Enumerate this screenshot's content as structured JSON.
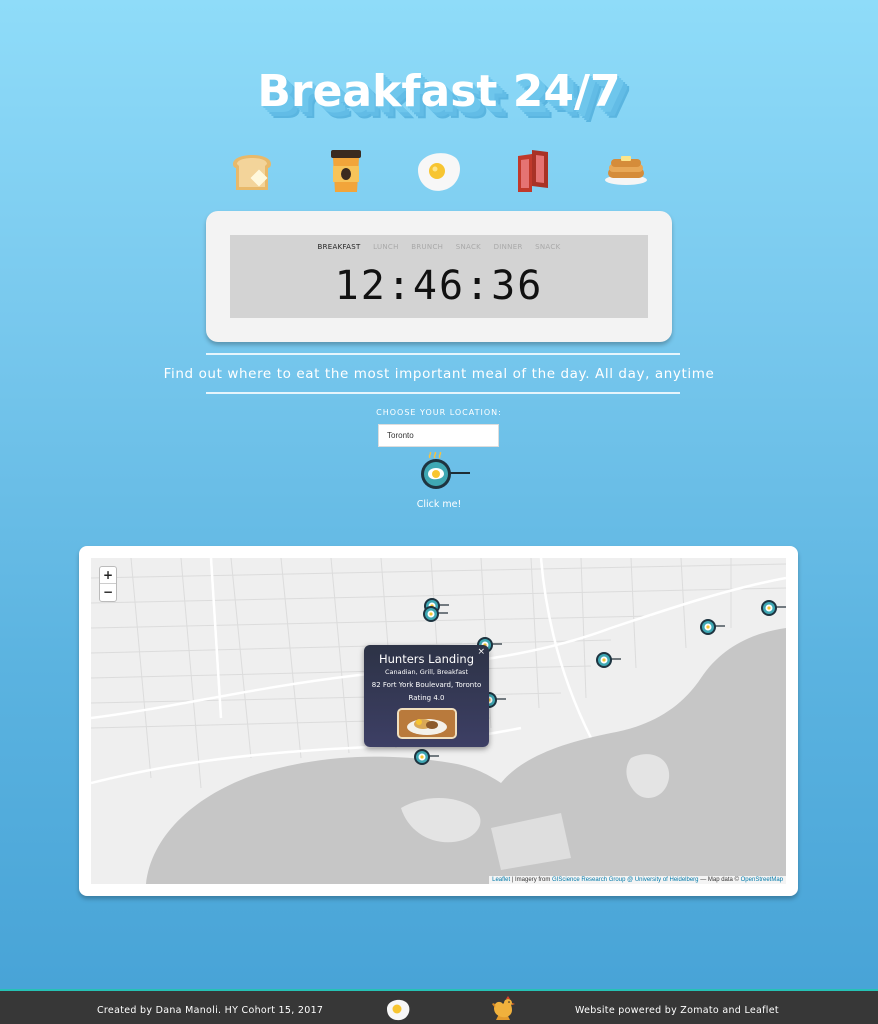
{
  "header": {
    "title": "Breakfast 24/7"
  },
  "food_icons": [
    "toast-icon",
    "coffee-cup-icon",
    "fried-egg-icon",
    "bacon-icon",
    "pancakes-icon"
  ],
  "clock": {
    "meals": [
      "BREAKFAST",
      "LUNCH",
      "BRUNCH",
      "SNACK",
      "DINNER",
      "SNACK"
    ],
    "active_meal": "BREAKFAST",
    "time": "12:46:36"
  },
  "tagline": "Find out where to eat the most important meal of the day. All day, anytime",
  "search": {
    "label": "CHOOSE YOUR LOCATION:",
    "value": "Toronto",
    "button_label": "Click me!"
  },
  "map": {
    "zoom_in": "+",
    "zoom_out": "−",
    "popup": {
      "name": "Hunters Landing",
      "cuisine": "Canadian, Grill, Breakfast",
      "address": "82 Fort York Boulevard, Toronto",
      "rating": "Rating  4.0",
      "close": "×"
    },
    "attribution": {
      "leaflet": "Leaflet",
      "imagery_prefix": " | Imagery from ",
      "provider": "GIScience Research Group @ University of Heidelberg",
      "data_prefix": " — Map data © ",
      "osm": "OpenStreetMap"
    }
  },
  "footer": {
    "left": "Created by Dana Manoli. HY Cohort 15, 2017",
    "right": "Website powered by Zomato and Leaflet"
  },
  "colors": {
    "sky_top": "#8fdcf9",
    "sky_bottom": "#46a2d6",
    "footer_bg": "#373737",
    "footer_accent": "#26c2b5",
    "popup_bg": "#353a55",
    "link": "#0078a8"
  }
}
